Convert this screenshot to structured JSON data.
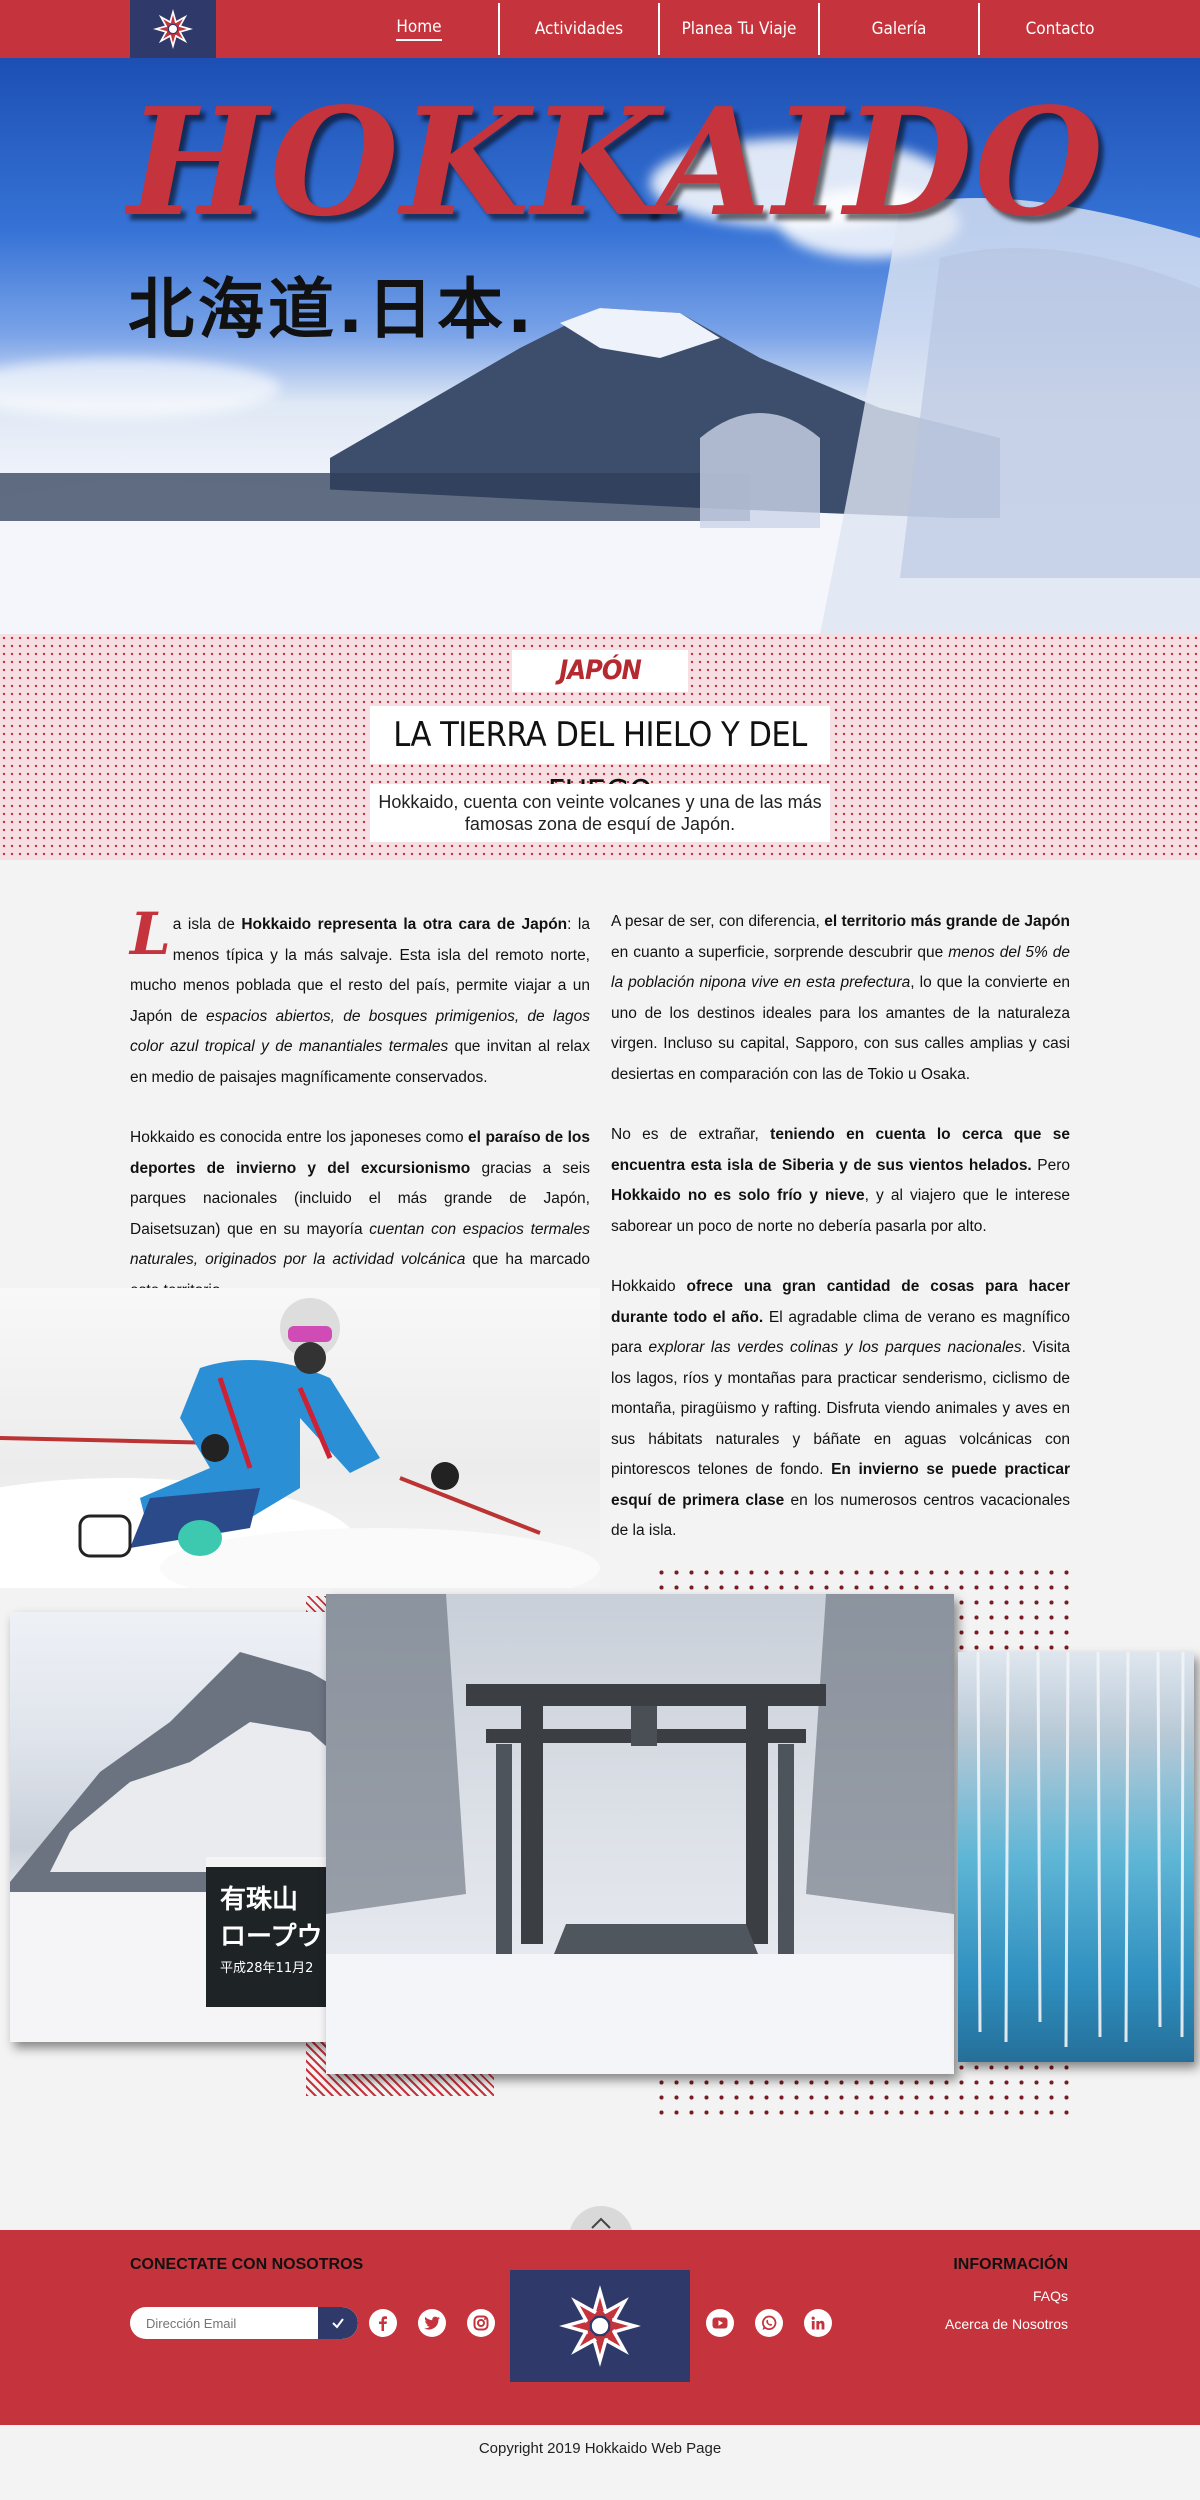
{
  "nav": {
    "items": [
      "Home",
      "Actividades",
      "Planea Tu Viaje",
      "Galería",
      "Contacto"
    ],
    "active_index": 0
  },
  "hero": {
    "title": "HOKKAIDO",
    "subtitle_jp": "北海道.日本."
  },
  "intro": {
    "label": "JAPÓN",
    "headline": "LA TIERRA DEL HIELO Y DEL FUEGO",
    "tagline": "Hokkaido, cuenta con veinte volcanes y una de las más famosas zona de esquí de Japón."
  },
  "article": {
    "left": [
      [
        {
          "t": "a isla de ",
          "s": ""
        },
        {
          "t": "Hokkaido representa la otra cara de Japón",
          "s": "b"
        },
        {
          "t": ": la menos típica y la más salvaje. Esta isla del remoto norte, mucho menos poblada que el resto del país, permite viajar a un Japón de ",
          "s": ""
        },
        {
          "t": "espacios abiertos, de bosques primigenios, de lagos color azul tropical y de manantiales termales",
          "s": "i"
        },
        {
          "t": " que invitan al relax en medio de paisajes magníficamente conservados.",
          "s": ""
        }
      ],
      [
        {
          "t": "Hokkaido es conocida entre los japoneses como ",
          "s": ""
        },
        {
          "t": "el paraíso de los deportes de invierno y del excursionismo",
          "s": "b"
        },
        {
          "t": " gracias a seis parques nacionales (incluido el más grande de Japón, Daisetsuzan) que en su mayoría ",
          "s": ""
        },
        {
          "t": "cuentan con espacios termales naturales, originados por la actividad volcánica",
          "s": "i"
        },
        {
          "t": " que ha marcado este territorio.",
          "s": ""
        }
      ]
    ],
    "left_dropcap": "L",
    "right": [
      [
        {
          "t": "A pesar de ser, con diferencia, ",
          "s": ""
        },
        {
          "t": "el territorio más grande de Japón",
          "s": "b"
        },
        {
          "t": " en cuanto a superficie, sorprende descubrir que ",
          "s": ""
        },
        {
          "t": "menos del 5% de la población nipona vive en esta prefectura",
          "s": "i"
        },
        {
          "t": ", lo que la convierte en uno de los destinos ideales para los amantes de la naturaleza virgen. Incluso su capital, Sapporo, con sus calles amplias y casi desiertas en comparación con las de Tokio u Osaka.",
          "s": ""
        }
      ],
      [
        {
          "t": "No es de extrañar, ",
          "s": ""
        },
        {
          "t": "teniendo en cuenta lo cerca que se encuentra esta isla de Siberia y de sus vientos helados.",
          "s": "b"
        },
        {
          "t": " Pero ",
          "s": ""
        },
        {
          "t": "Hokkaido no es solo frío y nieve",
          "s": "b"
        },
        {
          "t": ", y al viajero que le interese saborear un poco de norte no debería pasarla por alto.",
          "s": ""
        }
      ],
      [
        {
          "t": "Hokkaido ",
          "s": ""
        },
        {
          "t": "ofrece una gran cantidad de cosas para hacer durante todo el año.",
          "s": "b"
        },
        {
          "t": " El agradable clima de verano es magnífico para ",
          "s": ""
        },
        {
          "t": "explorar las verdes colinas y los parques nacionales",
          "s": "i"
        },
        {
          "t": ". Visita los lagos, ríos y montañas para practicar senderismo, ciclismo de montaña, piragüismo y rafting. Disfruta viendo animales y aves en sus hábitats naturales y báñate en aguas volcánicas con pintorescos telones de fondo. ",
          "s": ""
        },
        {
          "t": "En invierno se puede practicar esquí de primera clase",
          "s": "b"
        },
        {
          "t": " en los numerosos centros vacacionales de la isla.",
          "s": ""
        }
      ]
    ]
  },
  "gallery": {
    "sign_text": [
      "有珠山",
      "ロープウェ",
      "平成28年11月2"
    ]
  },
  "footer": {
    "connect_heading": "CONECTATE CON NOSOTROS",
    "email_placeholder": "Dirección Email",
    "info_heading": "INFORMACIÓN",
    "links": [
      "FAQs",
      "Acerca de Nosotros"
    ],
    "social_left": [
      "facebook-icon",
      "twitter-icon",
      "instagram-icon"
    ],
    "social_right": [
      "youtube-icon",
      "whatsapp-icon",
      "linkedin-icon"
    ],
    "copyright": "Copyright 2019 Hokkaido Web Page"
  },
  "colors": {
    "brand_red": "#c5343c",
    "brand_navy": "#2f3a6b",
    "background": "#f3f3f3"
  }
}
